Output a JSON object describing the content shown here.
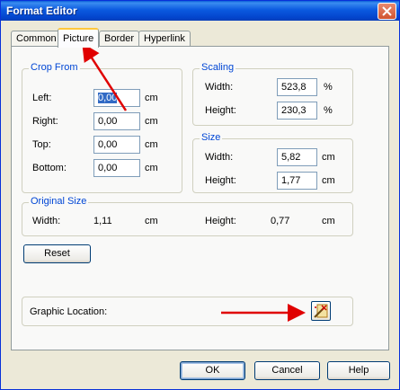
{
  "window": {
    "title": "Format Editor"
  },
  "tabs": [
    {
      "label": "Common"
    },
    {
      "label": "Picture",
      "active": true
    },
    {
      "label": "Border"
    },
    {
      "label": "Hyperlink"
    }
  ],
  "crop": {
    "title": "Crop From",
    "left": {
      "label": "Left:",
      "value": "0,00",
      "unit": "cm"
    },
    "right": {
      "label": "Right:",
      "value": "0,00",
      "unit": "cm"
    },
    "top": {
      "label": "Top:",
      "value": "0,00",
      "unit": "cm"
    },
    "bottom": {
      "label": "Bottom:",
      "value": "0,00",
      "unit": "cm"
    }
  },
  "scaling": {
    "title": "Scaling",
    "width": {
      "label": "Width:",
      "value": "523,8",
      "unit": "%"
    },
    "height": {
      "label": "Height:",
      "value": "230,3",
      "unit": "%"
    }
  },
  "size": {
    "title": "Size",
    "width": {
      "label": "Width:",
      "value": "5,82",
      "unit": "cm"
    },
    "height": {
      "label": "Height:",
      "value": "1,77",
      "unit": "cm"
    }
  },
  "original": {
    "title": "Original Size",
    "width_label": "Width:",
    "width_value": "1,11",
    "width_unit": "cm",
    "height_label": "Height:",
    "height_value": "0,77",
    "height_unit": "cm"
  },
  "reset_label": "Reset",
  "graphic_location_label": "Graphic Location:",
  "buttons": {
    "ok": "OK",
    "cancel": "Cancel",
    "help": "Help"
  },
  "colors": {
    "annotation_arrow": "#e00000",
    "group_title": "#0046d5"
  }
}
